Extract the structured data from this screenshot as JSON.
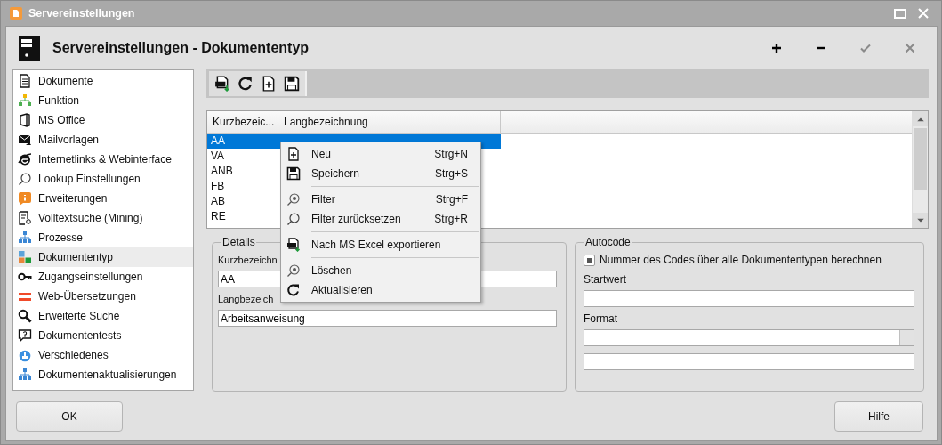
{
  "window": {
    "title": "Servereinstellungen"
  },
  "header": {
    "title": "Servereinstellungen - Dokumententyp",
    "actions": [
      {
        "disabled": false
      },
      {
        "disabled": false
      },
      {
        "disabled": true
      },
      {
        "disabled": true
      }
    ]
  },
  "sidebar": {
    "items": [
      {
        "label": "Dokumente",
        "selected": false
      },
      {
        "label": "Funktion",
        "selected": false
      },
      {
        "label": "MS Office",
        "selected": false
      },
      {
        "label": "Mailvorlagen",
        "selected": false
      },
      {
        "label": "Internetlinks & Webinterface",
        "selected": false
      },
      {
        "label": "Lookup Einstellungen",
        "selected": false
      },
      {
        "label": "Erweiterungen",
        "selected": false
      },
      {
        "label": "Volltextsuche (Mining)",
        "selected": false
      },
      {
        "label": "Prozesse",
        "selected": false
      },
      {
        "label": "Dokumententyp",
        "selected": true
      },
      {
        "label": "Zugangseinstellungen",
        "selected": false
      },
      {
        "label": "Web-Übersetzungen",
        "selected": false
      },
      {
        "label": "Erweiterte Suche",
        "selected": false
      },
      {
        "label": "Dokumententests",
        "selected": false
      },
      {
        "label": "Verschiedenes",
        "selected": false
      },
      {
        "label": "Dokumentenaktualisierungen",
        "selected": false
      }
    ]
  },
  "table": {
    "columns": [
      "Kurzbezeic...",
      "Langbezeichnung"
    ],
    "rows": [
      {
        "cells": [
          "AA"
        ],
        "selected": true
      },
      {
        "cells": [
          "VA"
        ],
        "selected": false
      },
      {
        "cells": [
          "ANB"
        ],
        "selected": false
      },
      {
        "cells": [
          "FB"
        ],
        "selected": false
      },
      {
        "cells": [
          "AB"
        ],
        "selected": false
      },
      {
        "cells": [
          "RE"
        ],
        "selected": false
      }
    ]
  },
  "details": {
    "title": "Details",
    "fields": [
      {
        "label": "Kurzbezeichn",
        "value": "AA"
      },
      {
        "label": "Langbezeich",
        "value": "Arbeitsanweisung"
      }
    ]
  },
  "autocode": {
    "title": "Autocode",
    "checkbox": {
      "label": "Nummer des Codes über alle Dokumententypen berechnen",
      "indeterminate": true
    },
    "fields": [
      {
        "label": "Startwert",
        "kind": "text"
      },
      {
        "label": "Format",
        "kind": "combo"
      },
      {
        "kind": "text"
      }
    ]
  },
  "context_menu": {
    "items": [
      {
        "kind": "item",
        "label": "Neu",
        "shortcut": "Strg+N"
      },
      {
        "kind": "item",
        "label": "Speichern",
        "shortcut": "Strg+S"
      },
      {
        "kind": "separator"
      },
      {
        "kind": "item",
        "label": "Filter",
        "shortcut": "Strg+F"
      },
      {
        "kind": "item",
        "label": "Filter zurücksetzen",
        "shortcut": "Strg+R"
      },
      {
        "kind": "separator"
      },
      {
        "kind": "item",
        "label": "Nach MS Excel exportieren"
      },
      {
        "kind": "separator"
      },
      {
        "kind": "item",
        "label": "Löschen"
      },
      {
        "kind": "item",
        "label": "Aktualisieren"
      }
    ]
  },
  "footer": {
    "ok_button": {
      "label": "OK"
    },
    "help_button": {
      "label": "Hilfe"
    }
  }
}
